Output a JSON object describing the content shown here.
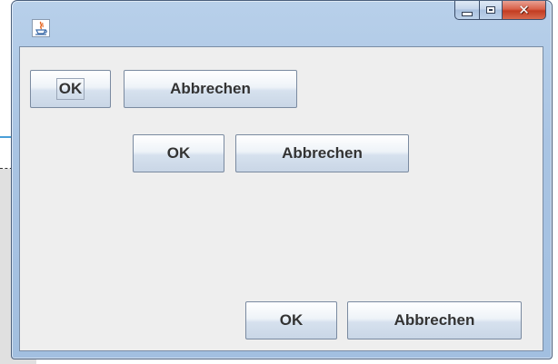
{
  "window": {
    "title": "",
    "icon": "java-cup-icon",
    "caption_buttons": {
      "minimize": "minimize-icon",
      "maximize": "maximize-icon",
      "close": "close-icon"
    }
  },
  "rows": [
    {
      "ok_label": "OK",
      "cancel_label": "Abbrechen",
      "alignment": "left",
      "ok_focused": true
    },
    {
      "ok_label": "OK",
      "cancel_label": "Abbrechen",
      "alignment": "center",
      "ok_focused": false
    },
    {
      "ok_label": "OK",
      "cancel_label": "Abbrechen",
      "alignment": "right",
      "ok_focused": false
    }
  ],
  "colors": {
    "client_background": "#eeeeee",
    "close_button": "#c23c22",
    "frame": "#a9c4e3"
  }
}
